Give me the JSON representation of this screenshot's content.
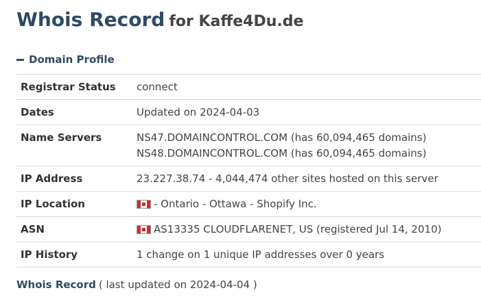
{
  "header": {
    "title": "Whois Record",
    "subtitle": "for Kaffe4Du.de"
  },
  "section": {
    "label": "Domain Profile"
  },
  "rows": [
    {
      "label": "Registrar Status",
      "lines": [
        "connect"
      ]
    },
    {
      "label": "Dates",
      "lines": [
        "Updated on 2024-04-03"
      ]
    },
    {
      "label": "Name Servers",
      "lines": [
        "NS47.DOMAINCONTROL.COM (has 60,094,465 domains)",
        "NS48.DOMAINCONTROL.COM (has 60,094,465 domains)"
      ]
    },
    {
      "label": "IP Address",
      "lines": [
        "23.227.38.74 - 4,044,474 other sites hosted on this server"
      ]
    },
    {
      "label": "IP Location",
      "lines": [
        "- Ontario - Ottawa - Shopify Inc."
      ]
    },
    {
      "label": "ASN",
      "lines": [
        "AS13335 CLOUDFLARENET, US (registered Jul 14, 2010)"
      ]
    },
    {
      "label": "IP History",
      "lines": [
        "1 change on 1 unique IP addresses over 0 years"
      ]
    }
  ],
  "footer": {
    "link": "Whois Record",
    "note": "( last updated on 2024-04-04 )"
  }
}
